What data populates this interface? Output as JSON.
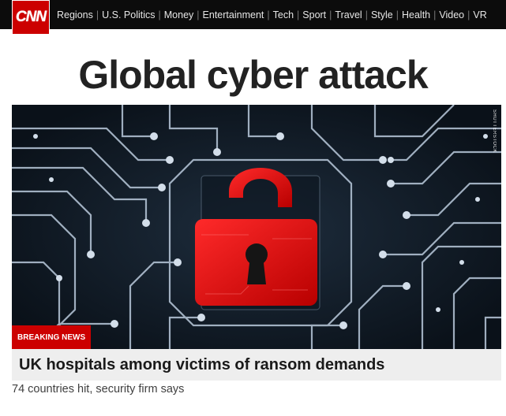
{
  "header": {
    "logo_text": "CNN",
    "nav_items": [
      "Regions",
      "U.S. Politics",
      "Money",
      "Entertainment",
      "Tech",
      "Sport",
      "Travel",
      "Style",
      "Health",
      "Video",
      "VR"
    ]
  },
  "story": {
    "headline": "Global cyber attack",
    "image_credit": "SHUTTERSTOCK",
    "badge": "BREAKING NEWS",
    "caption": "UK hospitals among victims of ransom demands",
    "subcaption": "74 countries hit, security firm says"
  },
  "colors": {
    "brand_red": "#cc0000",
    "topbar_bg": "#0c0c0c",
    "caption_bg": "#eeeeee"
  }
}
